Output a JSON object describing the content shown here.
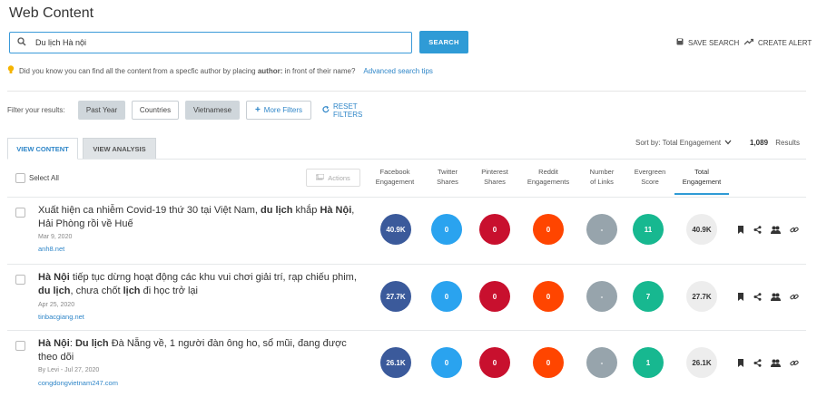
{
  "page": {
    "title": "Web Content"
  },
  "search": {
    "value": "Du lịch Hà nội",
    "button": "SEARCH"
  },
  "top_actions": {
    "save_search": "SAVE SEARCH",
    "create_alert": "CREATE ALERT"
  },
  "tip": {
    "prefix": "Did you know you can find all the content from a specfic author by placing ",
    "keyword": "author:",
    "suffix": " in front of their name?",
    "link": "Advanced search tips"
  },
  "filters": {
    "label": "Filter your results:",
    "past_year": "Past Year",
    "countries": "Countries",
    "language": "Vietnamese",
    "more": "More Filters",
    "reset": "RESET FILTERS"
  },
  "tabs": {
    "content": "VIEW CONTENT",
    "analysis": "VIEW ANALYSIS"
  },
  "sort": {
    "label": "Sort by: Total Engagement",
    "count": "1,089",
    "results_word": "Results"
  },
  "table": {
    "select_all": "Select All",
    "actions": "Actions",
    "columns": {
      "facebook": [
        "Facebook",
        "Engagement"
      ],
      "twitter": [
        "Twitter",
        "Shares"
      ],
      "pinterest": [
        "Pinterest",
        "Shares"
      ],
      "reddit": [
        "Reddit",
        "Engagements"
      ],
      "links": [
        "Number",
        "of Links"
      ],
      "evergreen": [
        "Evergreen",
        "Score"
      ],
      "total": [
        "Total",
        "Engagement"
      ]
    }
  },
  "rows": [
    {
      "title_parts": [
        {
          "t": "Xuất hiện ca nhiễm Covid-19 thứ 30 tại Việt Nam, ",
          "b": false
        },
        {
          "t": "du lịch",
          "b": true
        },
        {
          "t": " khắp ",
          "b": false
        },
        {
          "t": "Hà Nội",
          "b": true
        },
        {
          "t": ", Hải Phòng rồi về Huế",
          "b": false
        }
      ],
      "date": "Mar 9, 2020",
      "domain": "anh8.net",
      "facebook": "40.9K",
      "twitter": "0",
      "pinterest": "0",
      "reddit": "0",
      "links": "-",
      "evergreen": "11",
      "total": "40.9K"
    },
    {
      "title_parts": [
        {
          "t": "Hà Nội",
          "b": true
        },
        {
          "t": " tiếp tục dừng hoạt động các khu vui chơi giải trí, rạp chiếu phim, ",
          "b": false
        },
        {
          "t": "du lịch",
          "b": true
        },
        {
          "t": ", chưa chốt ",
          "b": false
        },
        {
          "t": "lịch",
          "b": true
        },
        {
          "t": " đi học trở lại",
          "b": false
        }
      ],
      "date": "Apr 25, 2020",
      "domain": "tinbacgiang.net",
      "facebook": "27.7K",
      "twitter": "0",
      "pinterest": "0",
      "reddit": "0",
      "links": "-",
      "evergreen": "7",
      "total": "27.7K"
    },
    {
      "title_parts": [
        {
          "t": "Hà Nội",
          "b": true
        },
        {
          "t": ": ",
          "b": false
        },
        {
          "t": "Du lịch",
          "b": true
        },
        {
          "t": " Đà Nẵng về, 1 người đàn ông ho, sổ mũi, đang được theo dõi",
          "b": false
        }
      ],
      "date": "By Levi - Jul 27, 2020",
      "domain": "congdongvietnam247.com",
      "facebook": "26.1K",
      "twitter": "0",
      "pinterest": "0",
      "reddit": "0",
      "links": "-",
      "evergreen": "1",
      "total": "26.1K"
    }
  ]
}
